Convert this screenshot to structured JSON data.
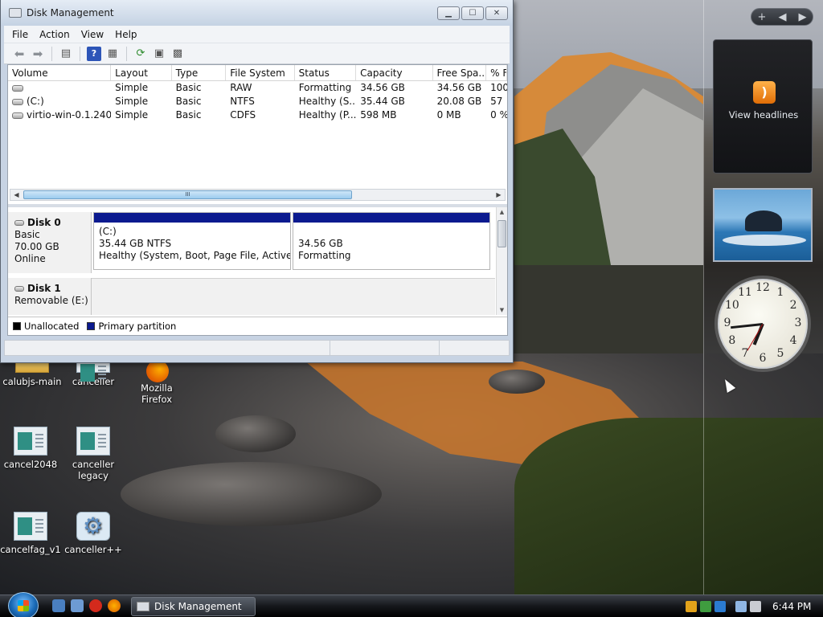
{
  "window": {
    "title": "Disk Management",
    "controls": {
      "minimize": "▁",
      "maximize": "☐",
      "close": "✕"
    }
  },
  "menu": [
    "File",
    "Action",
    "View",
    "Help"
  ],
  "toolbar_icons": [
    "back-arrow-icon",
    "forward-arrow-icon",
    "properties-icon",
    "help-icon",
    "console-icon",
    "refresh-icon",
    "export-icon",
    "settings-icon"
  ],
  "volume_table": {
    "columns": [
      "Volume",
      "Layout",
      "Type",
      "File System",
      "Status",
      "Capacity",
      "Free Spa...",
      "% F"
    ],
    "rows": [
      [
        "",
        "Simple",
        "Basic",
        "RAW",
        "Formatting",
        "34.56 GB",
        "34.56 GB",
        "100"
      ],
      [
        "(C:)",
        "Simple",
        "Basic",
        "NTFS",
        "Healthy (S...",
        "35.44 GB",
        "20.08 GB",
        "57"
      ],
      [
        "virtio-win-0.1.240 ...",
        "Simple",
        "Basic",
        "CDFS",
        "Healthy (P...",
        "598 MB",
        "0 MB",
        "0 %"
      ]
    ]
  },
  "scrollbar_grip": "III",
  "disks": [
    {
      "name": "Disk 0",
      "type": "Basic",
      "size": "70.00 GB",
      "state": "Online",
      "partitions": [
        {
          "line1": "(C:)",
          "line2": "35.44 GB NTFS",
          "line3": "Healthy (System, Boot, Page File, Active, Cra"
        },
        {
          "line1": "",
          "line2": "34.56 GB",
          "line3": "Formatting"
        }
      ]
    },
    {
      "name": "Disk 1",
      "type": "Removable (E:)"
    }
  ],
  "legend": [
    {
      "label": "Unallocated",
      "color": "#000000"
    },
    {
      "label": "Primary partition",
      "color": "#0b1a8f"
    }
  ],
  "desktop_icons": [
    {
      "label": "calubjs-main"
    },
    {
      "label": "canceller"
    },
    {
      "label": "Mozilla Firefox"
    },
    {
      "label": "cancel2048"
    },
    {
      "label": "canceller legacy"
    },
    {
      "label": "cancelfag_v1"
    },
    {
      "label": "canceller++"
    }
  ],
  "sidebar": {
    "controls": {
      "add": "+",
      "prev": "◀",
      "next": "▶"
    },
    "feed_label": "View headlines",
    "clock": {
      "hour": 6,
      "minute": 44,
      "numbers": [
        "12",
        "1",
        "2",
        "3",
        "4",
        "5",
        "6",
        "7",
        "8",
        "9",
        "10",
        "11"
      ]
    }
  },
  "taskbar": {
    "active_task": "Disk Management",
    "time": "6:44 PM"
  }
}
